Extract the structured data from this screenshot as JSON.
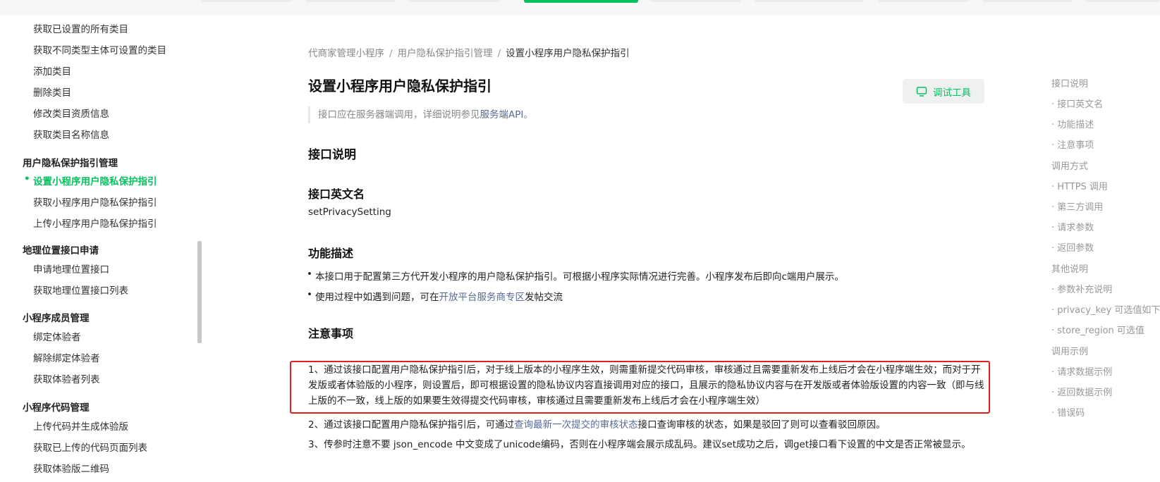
{
  "sidebar": {
    "items_top": [
      "获取已设置的所有类目",
      "获取不同类型主体可设置的类目",
      "添加类目",
      "删除类目",
      "修改类目资质信息",
      "获取类目名称信息"
    ],
    "group_privacy": "用户隐私保护指引管理",
    "privacy_items": [
      "设置小程序用户隐私保护指引",
      "获取小程序用户隐私保护指引",
      "上传小程序用户隐私保护指引"
    ],
    "group_location": "地理位置接口申请",
    "location_items": [
      "申请地理位置接口",
      "获取地理位置接口列表"
    ],
    "group_member": "小程序成员管理",
    "member_items": [
      "绑定体验者",
      "解除绑定体验者",
      "获取体验者列表"
    ],
    "group_code": "小程序代码管理",
    "code_items": [
      "上传代码并生成体验版",
      "获取已上传的代码页面列表",
      "获取体验版二维码"
    ]
  },
  "breadcrumb": [
    "代商家管理小程序",
    "用户隐私保护指引管理",
    "设置小程序用户隐私保护指引"
  ],
  "breadcrumb_sep": "/",
  "page_title": "设置小程序用户隐私保护指引",
  "debug_button": "调试工具",
  "note_prefix": "接口应在服务器端调用，详细说明参见",
  "note_link": "服务端API",
  "note_suffix": "。",
  "sections": {
    "interface_desc": "接口说明",
    "english_name_title": "接口英文名",
    "english_name": "setPrivacySetting",
    "func_title": "功能描述",
    "func_b1": "本接口用于配置第三方代开发小程序的用户隐私保护指引。可根据小程序实际情况进行完善。小程序发布后即向c端用户展示。",
    "func_b2_prefix": "使用过程中如遇到问题，可在",
    "func_b2_link": "开放平台服务商专区",
    "func_b2_suffix": "发帖交流",
    "notice_title": "注意事项",
    "notice_1": "1、通过该接口配置用户隐私保护指引后，对于线上版本的小程序生效，则需重新提交代码审核，审核通过且需要重新发布上线后才会在小程序端生效；而对于开发版或者体验版的小程序，则设置后，即可根据设置的隐私协议内容直接调用对应的接口，且展示的隐私协议内容与在开发版或者体验版设置的内容一致（即与线上版的不一致，线上版的如果要生效得提交代码审核，审核通过且需要重新发布上线后才会在小程序端生效）",
    "notice_2_prefix": "2、通过该接口配置用户隐私保护指引后，可通过",
    "notice_2_link": "查询最新一次提交的审核状态",
    "notice_2_suffix": "接口查询审核的状态，如果是驳回了则可以查看驳回原因。",
    "notice_3": "3、传参时注意不要 json_encode 中文变成了unicode编码，否则在小程序端会展示成乱码。建议set成功之后，调get接口看下设置的中文是否正常被显示。"
  },
  "toc": [
    "接口说明",
    "接口英文名",
    "功能描述",
    "注意事项",
    "调用方式",
    "HTTPS 调用",
    "第三方调用",
    "请求参数",
    "返回参数",
    "其他说明",
    "参数补充说明",
    "privacy_key 可选值如下",
    "store_region 可选值",
    "调用示例",
    "请求数据示例",
    "返回数据示例",
    "错误码"
  ],
  "colors": {
    "accent": "#07c160",
    "link": "#576b95",
    "highlight_border": "#e02020"
  }
}
